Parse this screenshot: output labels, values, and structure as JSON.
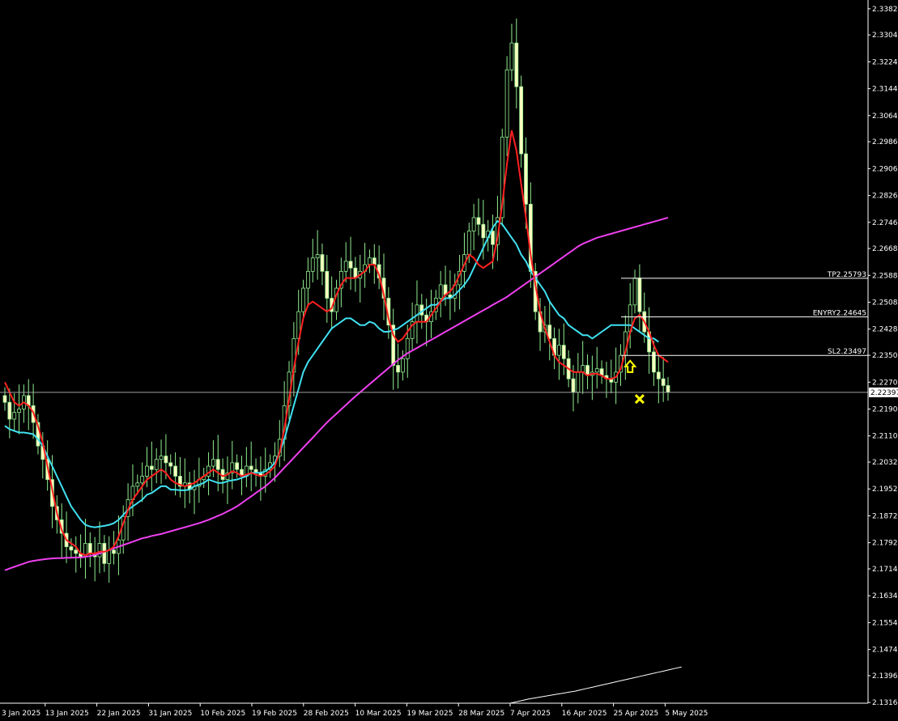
{
  "chart_data": {
    "type": "candlestick",
    "symbol_hidden": true,
    "y_range": [
      2.1314,
      2.3384
    ],
    "y_ticks": [
      "2.33820",
      "2.33040",
      "2.32240",
      "2.31440",
      "2.30640",
      "2.29860",
      "2.29060",
      "2.28260",
      "2.27460",
      "2.26680",
      "2.25880",
      "2.25080",
      "2.24280",
      "2.23500",
      "2.22700",
      "2.21900",
      "2.21100",
      "2.20320",
      "2.19520",
      "2.18720",
      "2.17920",
      "2.17140",
      "2.16340",
      "2.15540",
      "2.14740",
      "2.13960",
      "2.13160"
    ],
    "x_labels": [
      "3 Jan 2025",
      "13 Jan 2025",
      "22 Jan 2025",
      "31 Jan 2025",
      "10 Feb 2025",
      "19 Feb 2025",
      "28 Feb 2025",
      "10 Mar 2025",
      "19 Mar 2025",
      "28 Mar 2025",
      "7 Apr 2025",
      "16 Apr 2025",
      "25 Apr 2025",
      "5 May 2025"
    ],
    "current_price": "2.22397",
    "levels": [
      {
        "label": "TP2.25793",
        "value": 2.25793
      },
      {
        "label": "ENYRY2.24645",
        "value": 2.24645
      },
      {
        "label": "SL2.23497",
        "value": 2.23497
      }
    ],
    "closes": [
      2.221,
      2.216,
      2.218,
      2.219,
      2.223,
      2.22,
      2.215,
      2.208,
      2.204,
      2.198,
      2.19,
      2.186,
      2.182,
      2.178,
      2.177,
      2.176,
      2.175,
      2.179,
      2.176,
      2.175,
      2.179,
      2.173,
      2.177,
      2.176,
      2.18,
      2.187,
      2.192,
      2.196,
      2.197,
      2.199,
      2.202,
      2.201,
      2.204,
      2.205,
      2.203,
      2.202,
      2.199,
      2.196,
      2.197,
      2.195,
      2.196,
      2.198,
      2.199,
      2.202,
      2.204,
      2.201,
      2.198,
      2.2,
      2.203,
      2.201,
      2.199,
      2.202,
      2.201,
      2.2,
      2.199,
      2.201,
      2.203,
      2.205,
      2.21,
      2.22,
      2.23,
      2.24,
      2.248,
      2.255,
      2.26,
      2.264,
      2.265,
      2.26,
      2.252,
      2.248,
      2.255,
      2.26,
      2.263,
      2.261,
      2.258,
      2.26,
      2.262,
      2.264,
      2.262,
      2.258,
      2.252,
      2.244,
      2.232,
      2.23,
      2.234,
      2.24,
      2.245,
      2.25,
      2.247,
      2.245,
      2.248,
      2.252,
      2.256,
      2.253,
      2.252,
      2.256,
      2.26,
      2.265,
      2.272,
      2.276,
      2.274,
      2.27,
      2.272,
      2.268,
      2.276,
      2.3,
      2.32,
      2.328,
      2.315,
      2.295,
      2.28,
      2.26,
      2.248,
      2.242,
      2.244,
      2.24,
      2.235,
      2.238,
      2.234,
      2.228,
      2.224,
      2.23,
      2.232,
      2.229,
      2.23,
      2.231,
      2.229,
      2.228,
      2.227,
      2.23,
      2.235,
      2.242,
      2.25,
      2.258,
      2.248,
      2.242,
      2.236,
      2.23,
      2.228,
      2.226,
      2.224
    ],
    "ema_fast": [
      2.227,
      2.224,
      2.221,
      2.22,
      2.221,
      2.22,
      2.218,
      2.214,
      2.209,
      2.202,
      2.195,
      2.188,
      2.183,
      2.18,
      2.179,
      2.178,
      2.176,
      2.1755,
      2.176,
      2.176,
      2.1765,
      2.1765,
      2.177,
      2.178,
      2.181,
      2.185,
      2.189,
      2.192,
      2.194,
      2.196,
      2.198,
      2.199,
      2.2,
      2.201,
      2.2,
      2.198,
      2.197,
      2.1965,
      2.196,
      2.1965,
      2.197,
      2.198,
      2.199,
      2.2,
      2.201,
      2.2,
      2.199,
      2.1995,
      2.2005,
      2.2,
      2.199,
      2.1995,
      2.2,
      2.1995,
      2.199,
      2.1995,
      2.2005,
      2.202,
      2.206,
      2.213,
      2.222,
      2.231,
      2.239,
      2.246,
      2.25,
      2.251,
      2.25,
      2.249,
      2.248,
      2.249,
      2.253,
      2.256,
      2.258,
      2.258,
      2.258,
      2.259,
      2.26,
      2.262,
      2.262,
      2.259,
      2.253,
      2.246,
      2.241,
      2.239,
      2.24,
      2.242,
      2.244,
      2.245,
      2.245,
      2.245,
      2.247,
      2.249,
      2.251,
      2.253,
      2.254,
      2.256,
      2.259,
      2.262,
      2.265,
      2.264,
      2.262,
      2.261,
      2.262,
      2.263,
      2.27,
      2.28,
      2.292,
      2.302,
      2.296,
      2.286,
      2.276,
      2.265,
      2.256,
      2.248,
      2.243,
      2.239,
      2.235,
      2.233,
      2.232,
      2.231,
      2.23,
      2.23,
      2.23,
      2.229,
      2.2295,
      2.2295,
      2.229,
      2.228,
      2.228,
      2.2285,
      2.231,
      2.236,
      2.242,
      2.246,
      2.247,
      2.245,
      2.242,
      2.238,
      2.235,
      2.234,
      2.233
    ],
    "ema_mid": [
      2.214,
      2.213,
      2.2125,
      2.212,
      2.212,
      2.2118,
      2.2115,
      2.21,
      2.208,
      2.205,
      2.202,
      2.199,
      2.196,
      2.193,
      2.19,
      2.188,
      2.186,
      2.1845,
      2.184,
      2.1838,
      2.184,
      2.1842,
      2.1845,
      2.185,
      2.186,
      2.1875,
      2.189,
      2.19,
      2.191,
      2.192,
      2.1935,
      2.194,
      2.195,
      2.196,
      2.196,
      2.195,
      2.195,
      2.1948,
      2.1948,
      2.195,
      2.196,
      2.1965,
      2.197,
      2.198,
      2.1975,
      2.197,
      2.197,
      2.1975,
      2.1978,
      2.198,
      2.1985,
      2.199,
      2.2,
      2.2,
      2.2,
      2.2005,
      2.2015,
      2.203,
      2.206,
      2.21,
      2.215,
      2.22,
      2.225,
      2.23,
      2.233,
      2.235,
      2.237,
      2.239,
      2.241,
      2.243,
      2.244,
      2.245,
      2.246,
      2.246,
      2.245,
      2.244,
      2.244,
      2.245,
      2.2445,
      2.243,
      2.242,
      2.242,
      2.2425,
      2.243,
      2.244,
      2.245,
      2.246,
      2.247,
      2.248,
      2.249,
      2.25,
      2.25,
      2.251,
      2.252,
      2.252,
      2.253,
      2.2545,
      2.256,
      2.258,
      2.261,
      2.264,
      2.267,
      2.27,
      2.273,
      2.275,
      2.274,
      2.272,
      2.27,
      2.268,
      2.265,
      2.263,
      2.26,
      2.258,
      2.256,
      2.254,
      2.251,
      2.249,
      2.247,
      2.246,
      2.244,
      2.243,
      2.242,
      2.241,
      2.241,
      2.24,
      2.241,
      2.242,
      2.243,
      2.244,
      2.244,
      2.244,
      2.244,
      2.244,
      2.243,
      2.242,
      2.241,
      2.24,
      2.24,
      2.239
    ],
    "ema_slow": [
      2.171,
      2.1715,
      2.172,
      2.1725,
      2.173,
      2.1735,
      2.1738,
      2.174,
      2.1742,
      2.1744,
      2.1745,
      2.1746,
      2.1746,
      2.1747,
      2.1747,
      2.1748,
      2.1748,
      2.175,
      2.1752,
      2.1756,
      2.176,
      2.1765,
      2.177,
      2.1775,
      2.178,
      2.1785,
      2.179,
      2.1795,
      2.18,
      2.1805,
      2.1808,
      2.1812,
      2.1815,
      2.1818,
      2.1822,
      2.1826,
      2.183,
      2.1834,
      2.1838,
      2.1842,
      2.1846,
      2.185,
      2.1855,
      2.186,
      2.1866,
      2.1872,
      2.1878,
      2.1885,
      2.1892,
      2.19,
      2.191,
      2.192,
      2.193,
      2.194,
      2.195,
      2.196,
      2.1972,
      2.1985,
      2.2,
      2.2015,
      2.203,
      2.2045,
      2.206,
      2.2075,
      2.209,
      2.2105,
      2.212,
      2.2135,
      2.215,
      2.2163,
      2.2176,
      2.2189,
      2.2202,
      2.2215,
      2.2228,
      2.224,
      2.2252,
      2.2264,
      2.2276,
      2.2288,
      2.23,
      2.2312,
      2.2324,
      2.2336,
      2.2346,
      2.2356,
      2.2364,
      2.2372,
      2.238,
      2.2388,
      2.2396,
      2.2404,
      2.2412,
      2.242,
      2.2428,
      2.2436,
      2.2444,
      2.2452,
      2.246,
      2.2468,
      2.2476,
      2.2484,
      2.2492,
      2.25,
      2.2508,
      2.2516,
      2.2524,
      2.2534,
      2.2544,
      2.2554,
      2.2564,
      2.2574,
      2.2584,
      2.2594,
      2.2604,
      2.2614,
      2.2624,
      2.2634,
      2.2644,
      2.2654,
      2.2664,
      2.2674,
      2.2682,
      2.2688,
      2.2694,
      2.27,
      2.2704,
      2.2708,
      2.2712,
      2.2716,
      2.272,
      2.2724,
      2.2728,
      2.2732,
      2.2736,
      2.274,
      2.2744,
      2.2748,
      2.2752,
      2.2756,
      2.276
    ],
    "white_line": [
      2.1314,
      2.1318,
      2.1322,
      2.1326,
      2.1329,
      2.1332,
      2.1335,
      2.1338,
      2.1341,
      2.1344,
      2.1347,
      2.135,
      2.1354,
      2.1358,
      2.1362,
      2.1366,
      2.137,
      2.1374,
      2.1378,
      2.1382,
      2.1386,
      2.139,
      2.1394,
      2.1398,
      2.1402,
      2.1406,
      2.141,
      2.1414,
      2.1418,
      2.1422
    ],
    "colors": {
      "background": "#000000",
      "candle_bull": "#000000",
      "candle_outline": "#90ee90",
      "candle_bear_fill": "#ffffc0",
      "ema_fast": "#ff2020",
      "ema_mid": "#40e0f0",
      "ema_slow": "#ee40ee",
      "white_line": "#ffffff",
      "arrow": "#ffff00",
      "axis": "#ffffff"
    },
    "markers": [
      {
        "type": "arrow-up",
        "value": 2.23,
        "index": 132
      },
      {
        "type": "cross",
        "value": 2.222,
        "index": 134
      }
    ]
  }
}
